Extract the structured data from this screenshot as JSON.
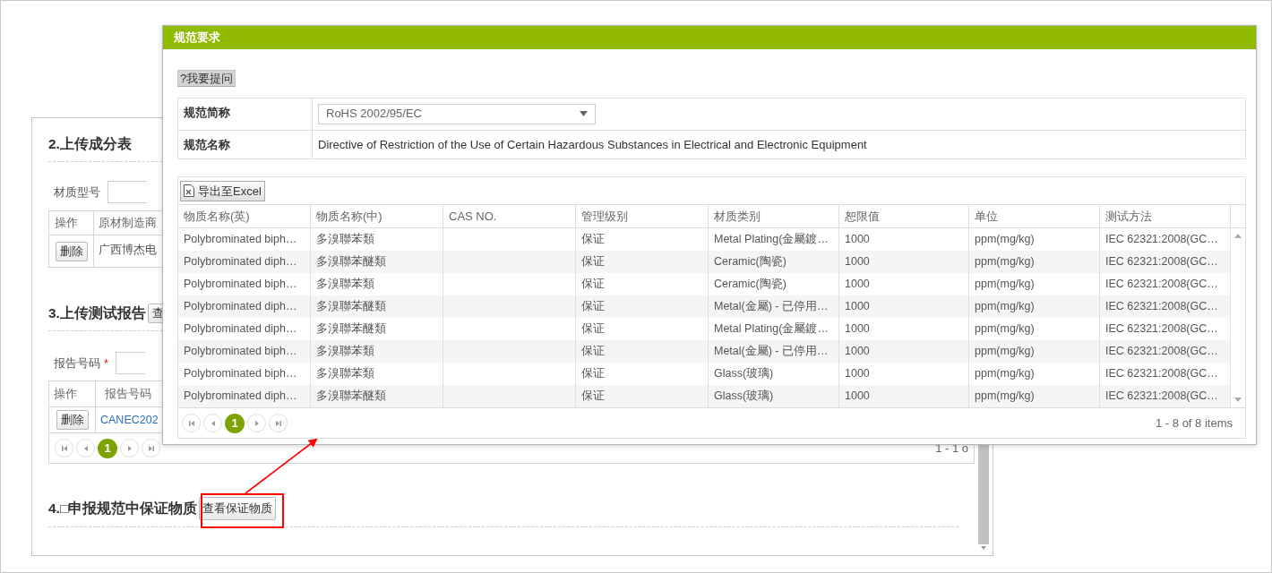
{
  "page": {
    "composition": {
      "heading": "2.上传成分表",
      "field_label": "材质型号",
      "columns": [
        "操作",
        "原材制造商"
      ],
      "rows": [
        {
          "action": "删除",
          "manufacturer": "广西博杰电"
        }
      ]
    },
    "test_report": {
      "heading": "3.上传测试报告",
      "button": "查",
      "field_label": "报告号码",
      "required_mark": "*",
      "columns": [
        "操作",
        "报告号码"
      ],
      "rows": [
        {
          "action": "删除",
          "report_no": "CANEC202"
        }
      ],
      "pager": {
        "pages": [
          {
            "label": "1",
            "selected": true
          }
        ],
        "summary": "1 - 1 o"
      }
    },
    "guaranteed": {
      "heading": "4.□申报规范中保证物质",
      "button": "查看保证物质"
    }
  },
  "modal": {
    "title": "规范要求",
    "ask_button": "?我要提问",
    "fields": [
      {
        "label": "规范简称",
        "kind": "select",
        "value": "RoHS 2002/95/EC"
      },
      {
        "label": "规范名称",
        "kind": "text",
        "value": "Directive of Restriction of the Use of Certain Hazardous Substances in Electrical and Electronic Equipment"
      }
    ],
    "export_button": "导出至Excel",
    "grid": {
      "columns": [
        "物质名称(英)",
        "物质名称(中)",
        "CAS NO.",
        "管理级别",
        "材质类别",
        "恕限值",
        "单位",
        "测试方法"
      ],
      "rows": [
        [
          "Polybrominated biph…",
          "多溴聯苯類",
          "",
          "保证",
          "Metal Plating(金屬鍍…",
          "1000",
          "ppm(mg/kg)",
          "IEC 62321:2008(GC…"
        ],
        [
          "Polybrominated diph…",
          "多溴聯苯醚類",
          "",
          "保证",
          "Ceramic(陶瓷)",
          "1000",
          "ppm(mg/kg)",
          "IEC 62321:2008(GC…"
        ],
        [
          "Polybrominated biph…",
          "多溴聯苯類",
          "",
          "保证",
          "Ceramic(陶瓷)",
          "1000",
          "ppm(mg/kg)",
          "IEC 62321:2008(GC…"
        ],
        [
          "Polybrominated diph…",
          "多溴聯苯醚類",
          "",
          "保证",
          "Metal(金屬) - 已停用…",
          "1000",
          "ppm(mg/kg)",
          "IEC 62321:2008(GC…"
        ],
        [
          "Polybrominated diph…",
          "多溴聯苯醚類",
          "",
          "保证",
          "Metal Plating(金屬鍍…",
          "1000",
          "ppm(mg/kg)",
          "IEC 62321:2008(GC…"
        ],
        [
          "Polybrominated biph…",
          "多溴聯苯類",
          "",
          "保证",
          "Metal(金屬) - 已停用…",
          "1000",
          "ppm(mg/kg)",
          "IEC 62321:2008(GC…"
        ],
        [
          "Polybrominated biph…",
          "多溴聯苯類",
          "",
          "保证",
          "Glass(玻璃)",
          "1000",
          "ppm(mg/kg)",
          "IEC 62321:2008(GC…"
        ],
        [
          "Polybrominated diph…",
          "多溴聯苯醚類",
          "",
          "保证",
          "Glass(玻璃)",
          "1000",
          "ppm(mg/kg)",
          "IEC 62321:2008(GC…"
        ]
      ],
      "pager": {
        "pages": [
          {
            "label": "1",
            "selected": true
          }
        ],
        "summary": "1 - 8 of 8 items"
      }
    }
  }
}
